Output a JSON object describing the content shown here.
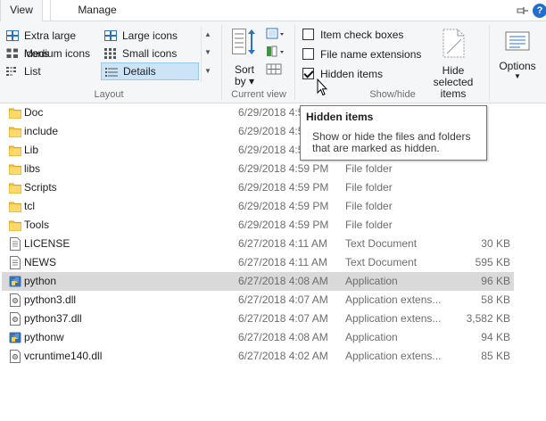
{
  "ribbon_tabs": {
    "view": "View",
    "manage": "Manage"
  },
  "layout": {
    "group_label": "Layout",
    "items": [
      {
        "label": "Extra large icons",
        "icon": "extra-large-icons-icon"
      },
      {
        "label": "Large icons",
        "icon": "large-icons-icon"
      },
      {
        "label": "Medium icons",
        "icon": "medium-icons-icon"
      },
      {
        "label": "Small icons",
        "icon": "small-icons-icon"
      },
      {
        "label": "List",
        "icon": "list-icon"
      },
      {
        "label": "Details",
        "icon": "details-icon",
        "selected": true
      }
    ]
  },
  "current_view": {
    "group_label": "Current view",
    "sort_label_1": "Sort",
    "sort_label_2": "by"
  },
  "show_hide": {
    "group_label": "Show/hide",
    "item_check_boxes": {
      "label": "Item check boxes",
      "checked": false
    },
    "file_name_extensions": {
      "label": "File name extensions",
      "checked": false
    },
    "hidden_items": {
      "label": "Hidden items",
      "checked": true
    },
    "hide_selected_1": "Hide selected",
    "hide_selected_2": "items"
  },
  "options": {
    "label": "Options"
  },
  "tooltip": {
    "title": "Hidden items",
    "body": "Show or hide the files and folders that are marked as hidden."
  },
  "files": [
    {
      "name": "Doc",
      "date": "6/29/2018 4:5",
      "type": "",
      "size": "",
      "icon": "folder-icon"
    },
    {
      "name": "include",
      "date": "6/29/2018 4:5",
      "type": "",
      "size": "",
      "icon": "folder-icon"
    },
    {
      "name": "Lib",
      "date": "6/29/2018 4:5",
      "type": "",
      "size": "",
      "icon": "folder-icon"
    },
    {
      "name": "libs",
      "date": "6/29/2018 4:59 PM",
      "type": "File folder",
      "size": "",
      "icon": "folder-icon"
    },
    {
      "name": "Scripts",
      "date": "6/29/2018 4:59 PM",
      "type": "File folder",
      "size": "",
      "icon": "folder-icon"
    },
    {
      "name": "tcl",
      "date": "6/29/2018 4:59 PM",
      "type": "File folder",
      "size": "",
      "icon": "folder-icon"
    },
    {
      "name": "Tools",
      "date": "6/29/2018 4:59 PM",
      "type": "File folder",
      "size": "",
      "icon": "folder-icon"
    },
    {
      "name": "LICENSE",
      "date": "6/27/2018 4:11 AM",
      "type": "Text Document",
      "size": "30 KB",
      "icon": "text-document-icon"
    },
    {
      "name": "NEWS",
      "date": "6/27/2018 4:11 AM",
      "type": "Text Document",
      "size": "595 KB",
      "icon": "text-document-icon"
    },
    {
      "name": "python",
      "date": "6/27/2018 4:08 AM",
      "type": "Application",
      "size": "96 KB",
      "icon": "python-app-icon",
      "selected": true
    },
    {
      "name": "python3.dll",
      "date": "6/27/2018 4:07 AM",
      "type": "Application extens...",
      "size": "58 KB",
      "icon": "dll-icon"
    },
    {
      "name": "python37.dll",
      "date": "6/27/2018 4:07 AM",
      "type": "Application extens...",
      "size": "3,582 KB",
      "icon": "dll-icon"
    },
    {
      "name": "pythonw",
      "date": "6/27/2018 4:08 AM",
      "type": "Application",
      "size": "94 KB",
      "icon": "python-app-icon"
    },
    {
      "name": "vcruntime140.dll",
      "date": "6/27/2018 4:02 AM",
      "type": "Application extens...",
      "size": "85 KB",
      "icon": "dll-icon"
    }
  ]
}
